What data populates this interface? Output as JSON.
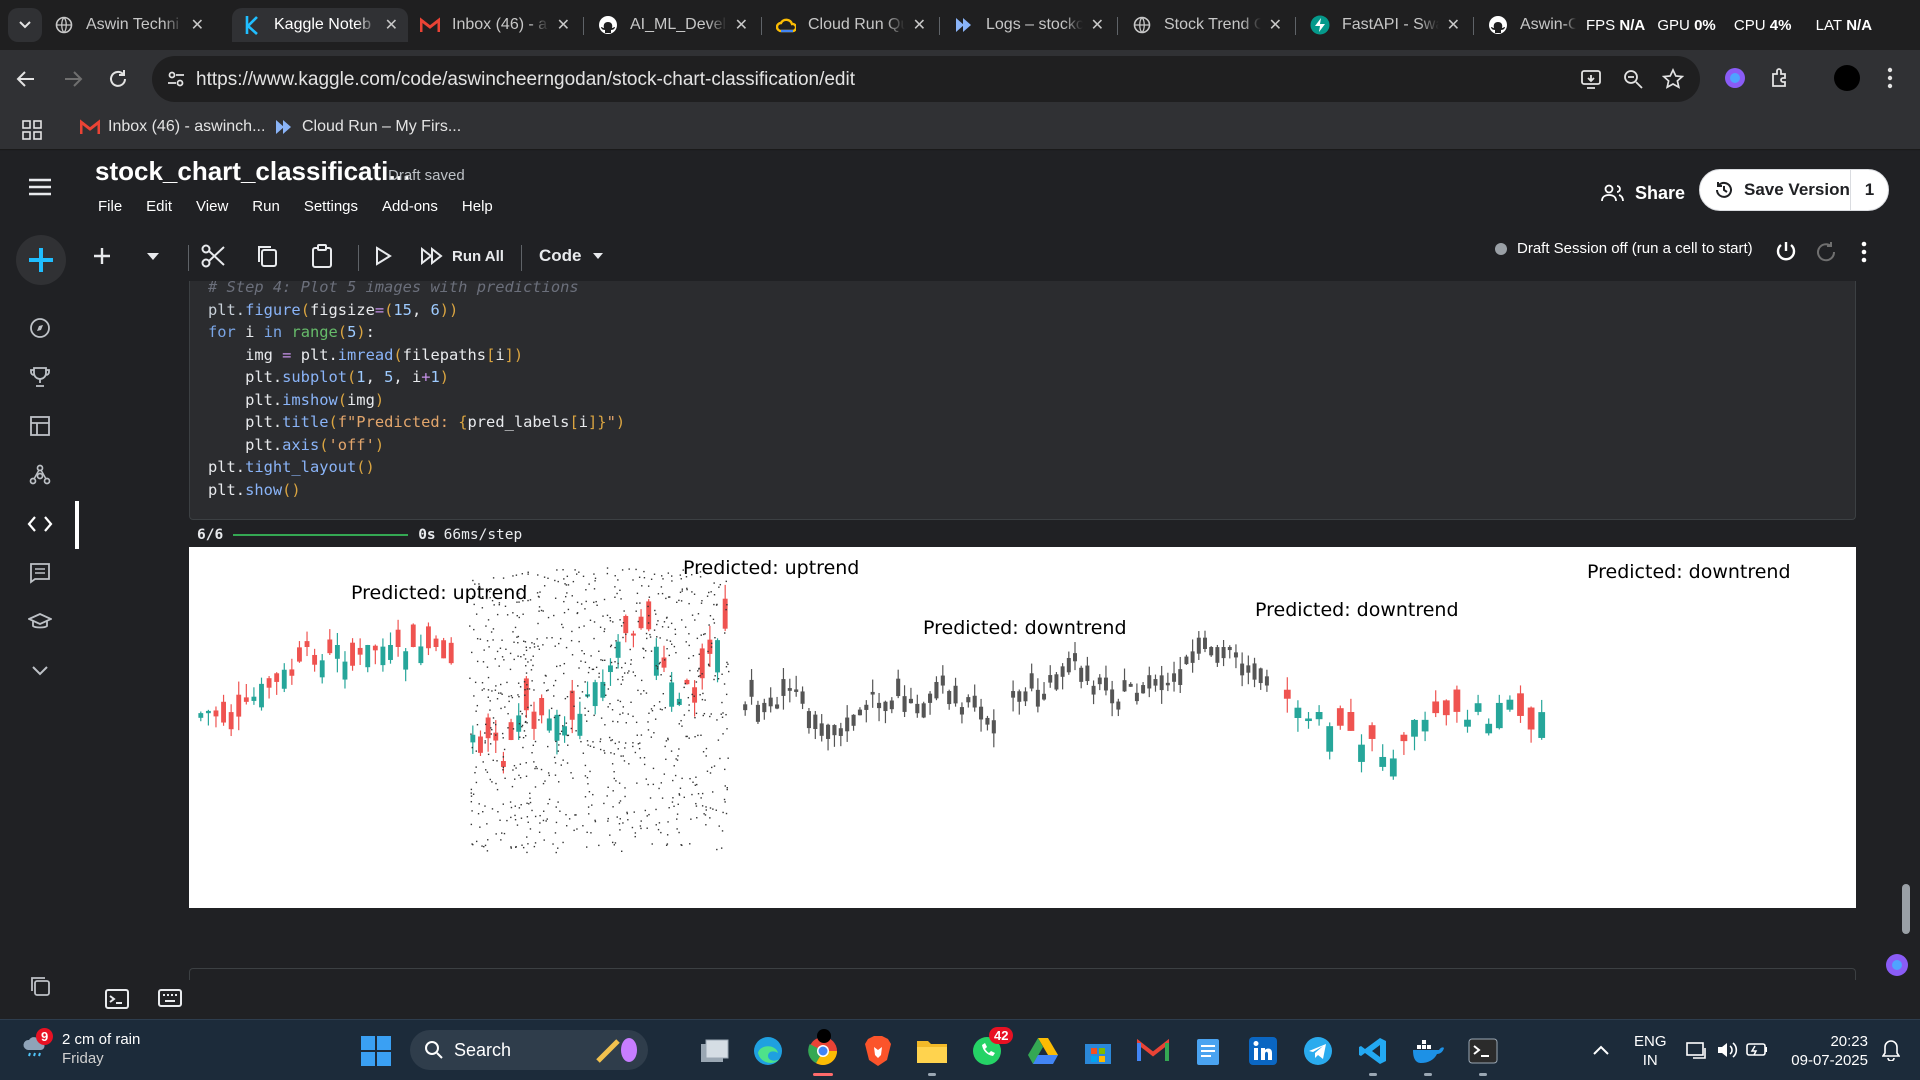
{
  "browser": {
    "tabs": [
      {
        "title": "Aswin Techni",
        "icon": "globe-icon"
      },
      {
        "title": "Kaggle Noteb",
        "icon": "kaggle-icon",
        "active": true
      },
      {
        "title": "Inbox (46) - a",
        "icon": "gmail-icon"
      },
      {
        "title": "AI_ML_Develo",
        "icon": "github-icon"
      },
      {
        "title": "Cloud Run Qu",
        "icon": "cloud-icon"
      },
      {
        "title": "Logs – stockc",
        "icon": "logs-icon"
      },
      {
        "title": "Stock Trend C",
        "icon": "globe-icon"
      },
      {
        "title": "FastAPI - Swa",
        "icon": "fastapi-icon"
      },
      {
        "title": "Aswin-Chee",
        "icon": "github-icon"
      }
    ],
    "perf": {
      "fps_label": "FPS",
      "fps_value": "N/A",
      "gpu_label": "GPU",
      "gpu_value": "0%",
      "cpu_label": "CPU",
      "cpu_value": "4%",
      "lat_label": "LAT",
      "lat_value": "N/A"
    },
    "url": "https://www.kaggle.com/code/aswincheerngodan/stock-chart-classification/edit",
    "bookmarks": [
      {
        "label": "Inbox (46) - aswinch...",
        "icon": "gmail-icon"
      },
      {
        "label": "Cloud Run – My Firs...",
        "icon": "cloud-run-icon"
      }
    ]
  },
  "notebook": {
    "title": "stock_chart_classificati...",
    "status": "Draft saved",
    "menus": [
      "File",
      "Edit",
      "View",
      "Run",
      "Settings",
      "Add-ons",
      "Help"
    ],
    "share_label": "Share",
    "save_version_label": "Save Version",
    "version_count": "1",
    "run_all_label": "Run All",
    "cell_type": "Code",
    "session_status": "Draft Session off (run a cell to start)",
    "code_lines": [
      "# Step 4: Plot 5 images with predictions",
      "plt.figure(figsize=(15, 6))",
      "for i in range(5):",
      "    img = plt.imread(filepaths[i])",
      "    plt.subplot(1, 5, i+1)",
      "    plt.imshow(img)",
      "    plt.title(f\"Predicted: {pred_labels[i]}\")",
      "    plt.axis('off')",
      "plt.tight_layout()",
      "plt.show()"
    ],
    "progress": {
      "steps": "6/6",
      "progress_fraction": 1.0,
      "time": "0s",
      "rate": "66ms/step"
    },
    "outputs": [
      {
        "title": "Predicted: uptrend"
      },
      {
        "title": "Predicted: uptrend"
      },
      {
        "title": "Predicted: downtrend"
      },
      {
        "title": "Predicted: downtrend"
      },
      {
        "title": "Predicted: downtrend"
      }
    ]
  },
  "taskbar": {
    "weather": {
      "text": "2 cm of rain",
      "day": "Friday",
      "badge": "9"
    },
    "search_label": "Search",
    "whatsapp_badge": "42",
    "language": {
      "lang": "ENG",
      "region": "IN"
    },
    "clock": {
      "time": "20:23",
      "date": "09-07-2025"
    }
  },
  "colors": {
    "kaggle_blue": "#20beff",
    "up": "#26a69a",
    "down": "#ef5350"
  }
}
